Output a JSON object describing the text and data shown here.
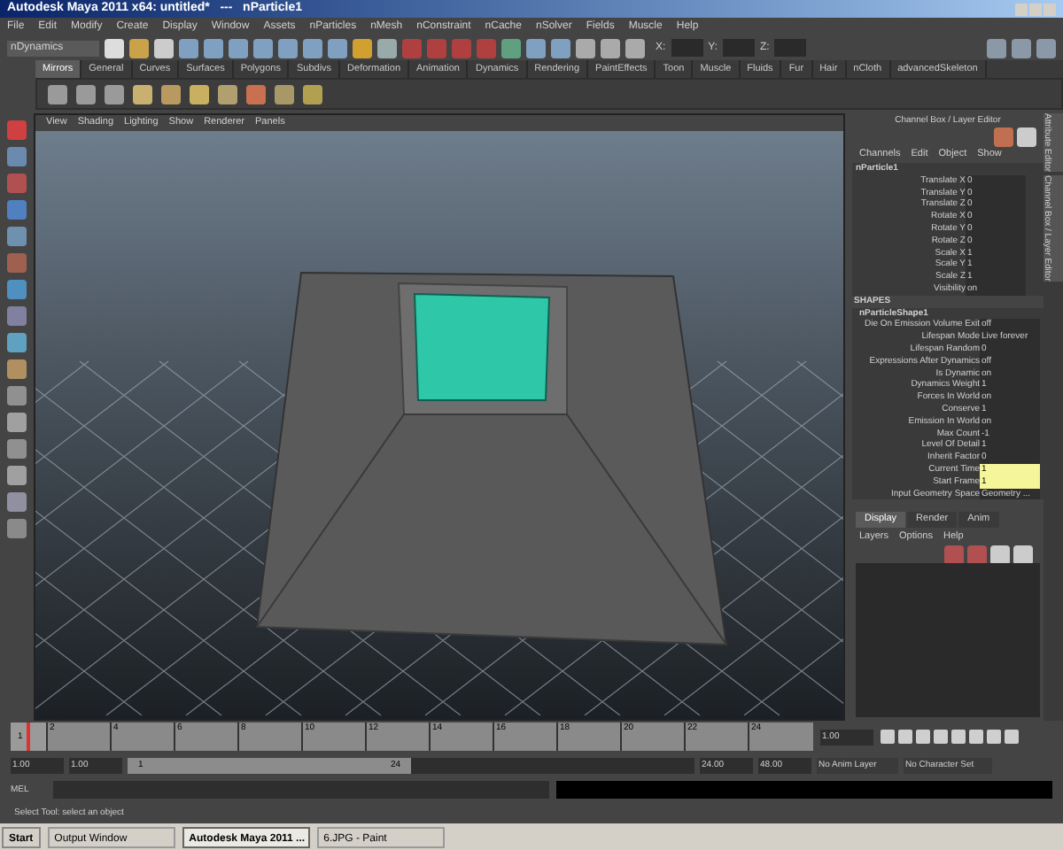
{
  "window": {
    "title": "Autodesk Maya 2011 x64: untitled*   ---   nParticle1"
  },
  "menu": [
    "File",
    "Edit",
    "Modify",
    "Create",
    "Display",
    "Window",
    "Assets",
    "nParticles",
    "nMesh",
    "nConstraint",
    "nCache",
    "nSolver",
    "Fields",
    "Muscle",
    "Help"
  ],
  "status_line": {
    "menu_set": "nDynamics",
    "x_label": "X:",
    "y_label": "Y:",
    "z_label": "Z:"
  },
  "shelf_tabs": [
    {
      "label": "Mirrors",
      "selected": true
    },
    {
      "label": "General",
      "selected": false
    },
    {
      "label": "Curves",
      "selected": false
    },
    {
      "label": "Surfaces",
      "selected": false
    },
    {
      "label": "Polygons",
      "selected": false
    },
    {
      "label": "Subdivs",
      "selected": false
    },
    {
      "label": "Deformation",
      "selected": false
    },
    {
      "label": "Animation",
      "selected": false
    },
    {
      "label": "Dynamics",
      "selected": false
    },
    {
      "label": "Rendering",
      "selected": false
    },
    {
      "label": "PaintEffects",
      "selected": false
    },
    {
      "label": "Toon",
      "selected": false
    },
    {
      "label": "Muscle",
      "selected": false
    },
    {
      "label": "Fluids",
      "selected": false
    },
    {
      "label": "Fur",
      "selected": false
    },
    {
      "label": "Hair",
      "selected": false
    },
    {
      "label": "nCloth",
      "selected": false
    },
    {
      "label": "advancedSkeleton",
      "selected": false
    }
  ],
  "viewport": {
    "menu": [
      "View",
      "Shading",
      "Lighting",
      "Show",
      "Renderer",
      "Panels"
    ]
  },
  "channel_box": {
    "title": "Channel Box / Layer Editor",
    "menu": [
      "Channels",
      "Edit",
      "Object",
      "Show"
    ],
    "node": "nParticle1",
    "transform": [
      {
        "name": "Translate X",
        "value": "0"
      },
      {
        "name": "Translate Y",
        "value": "0"
      },
      {
        "name": "Translate Z",
        "value": "0"
      },
      {
        "name": "Rotate X",
        "value": "0"
      },
      {
        "name": "Rotate Y",
        "value": "0"
      },
      {
        "name": "Rotate Z",
        "value": "0"
      },
      {
        "name": "Scale X",
        "value": "1"
      },
      {
        "name": "Scale Y",
        "value": "1"
      },
      {
        "name": "Scale Z",
        "value": "1"
      },
      {
        "name": "Visibility",
        "value": "on"
      }
    ],
    "shapes_label": "SHAPES",
    "shape_node": "nParticleShape1",
    "shape_attrs": [
      {
        "name": "Die On Emission Volume Exit",
        "value": "off",
        "highlighted": false
      },
      {
        "name": "Lifespan Mode",
        "value": "Live forever",
        "highlighted": false
      },
      {
        "name": "Lifespan Random",
        "value": "0",
        "highlighted": false
      },
      {
        "name": "Expressions After Dynamics",
        "value": "off",
        "highlighted": false
      },
      {
        "name": "Is Dynamic",
        "value": "on",
        "highlighted": false
      },
      {
        "name": "Dynamics Weight",
        "value": "1",
        "highlighted": false
      },
      {
        "name": "Forces In World",
        "value": "on",
        "highlighted": false
      },
      {
        "name": "Conserve",
        "value": "1",
        "highlighted": false
      },
      {
        "name": "Emission In World",
        "value": "on",
        "highlighted": false
      },
      {
        "name": "Max Count",
        "value": "-1",
        "highlighted": false
      },
      {
        "name": "Level Of Detail",
        "value": "1",
        "highlighted": false
      },
      {
        "name": "Inherit Factor",
        "value": "0",
        "highlighted": false
      },
      {
        "name": "Current Time",
        "value": "1",
        "highlighted": true
      },
      {
        "name": "Start Frame",
        "value": "1",
        "highlighted": true
      },
      {
        "name": "Input Geometry Space",
        "value": "Geometry ...",
        "highlighted": false
      }
    ],
    "layer_tabs": [
      {
        "label": "Display",
        "selected": true
      },
      {
        "label": "Render",
        "selected": false
      },
      {
        "label": "Anim",
        "selected": false
      }
    ],
    "layer_menu": [
      "Layers",
      "Options",
      "Help"
    ]
  },
  "side_tabs": [
    "Attribute Editor",
    "Channel Box / Layer Editor"
  ],
  "time_slider": {
    "ticks": [
      "2",
      "4",
      "6",
      "8",
      "10",
      "12",
      "14",
      "16",
      "18",
      "20",
      "22",
      "24"
    ],
    "current_frame": "1",
    "current_time": "1.00",
    "level": 0.02
  },
  "range_slider": {
    "start": "1.00",
    "playback_start": "1.00",
    "range_start": "1",
    "range_end": "24",
    "level": 0.5,
    "playback_end": "24.00",
    "end": "48.00",
    "anim_layer": "No Anim Layer",
    "character_set": "No Character Set"
  },
  "command_line": {
    "label": "MEL"
  },
  "help_line": "Select Tool: select an object",
  "taskbar": {
    "start": "Start",
    "items": [
      {
        "label": "Output Window",
        "selected": false
      },
      {
        "label": "Autodesk Maya 2011 ...",
        "selected": true
      },
      {
        "label": "6.JPG - Paint",
        "selected": false
      }
    ]
  }
}
